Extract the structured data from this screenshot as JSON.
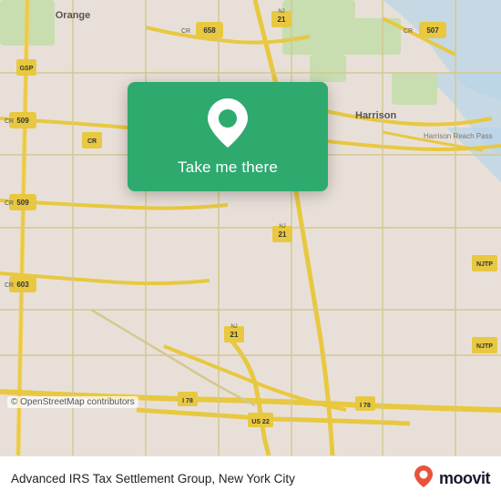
{
  "map": {
    "background_color": "#e8e0d8",
    "copyright": "© OpenStreetMap contributors"
  },
  "card": {
    "button_label": "Take me there",
    "pin_icon": "location-pin-icon"
  },
  "bottom_bar": {
    "business_name": "Advanced IRS Tax Settlement Group, New York City",
    "moovit_logo_text": "moovit",
    "moovit_pin_icon": "moovit-pin-icon"
  }
}
